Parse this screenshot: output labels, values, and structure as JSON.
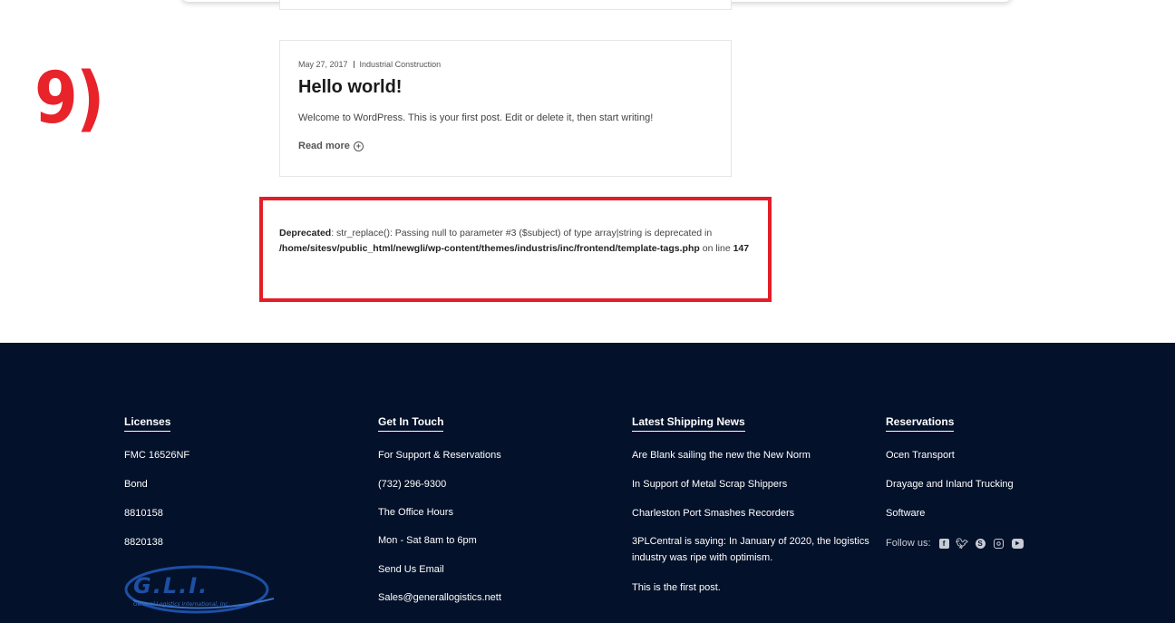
{
  "annotation": {
    "label": "9)"
  },
  "post": {
    "date": "May 27, 2017",
    "category": "Industrial Construction",
    "title": "Hello world!",
    "excerpt": "Welcome to WordPress. This is your first post. Edit or delete it, then start writing!",
    "read_more": "Read more"
  },
  "notice": {
    "label": "Deprecated",
    "message": ": str_replace(): Passing null to parameter #3 ($subject) of type array|string is deprecated in",
    "path": "/home/sitesv/public_html/newgli/wp-content/themes/industris/inc/frontend/template-tags.php",
    "on_line": " on line ",
    "line": "147"
  },
  "footer": {
    "licenses": {
      "heading": "Licenses",
      "items": [
        "FMC 16526NF",
        "Bond",
        "8810158",
        "8820138"
      ]
    },
    "contact": {
      "heading": "Get In Touch",
      "items": [
        "For Support & Reservations",
        "(732) 296-9300",
        "The Office Hours",
        "Mon - Sat 8am to 6pm",
        "Send Us Email",
        "Sales@generallogistics.nett"
      ]
    },
    "news": {
      "heading": "Latest Shipping News",
      "items": [
        "Are Blank sailing the new the New Norm",
        "In Support of Metal Scrap Shippers",
        "Charleston Port Smashes Recorders",
        "3PLCentral is saying: In January of 2020, the logistics industry was ripe with optimism.",
        "This is the first post."
      ]
    },
    "reservations": {
      "heading": "Reservations",
      "items": [
        "Ocen Transport",
        "Drayage and Inland Trucking",
        "Software"
      ],
      "follow_label": "Follow us:",
      "social_icons": [
        "facebook-icon",
        "twitter-icon",
        "skype-icon",
        "instagram-icon",
        "youtube-icon"
      ]
    },
    "logo": {
      "mark": "G.L.I.",
      "tagline": "General Logistics International, Inc."
    }
  },
  "colors": {
    "footer_bg": "#03112a",
    "annotation_red": "#e31e26"
  }
}
